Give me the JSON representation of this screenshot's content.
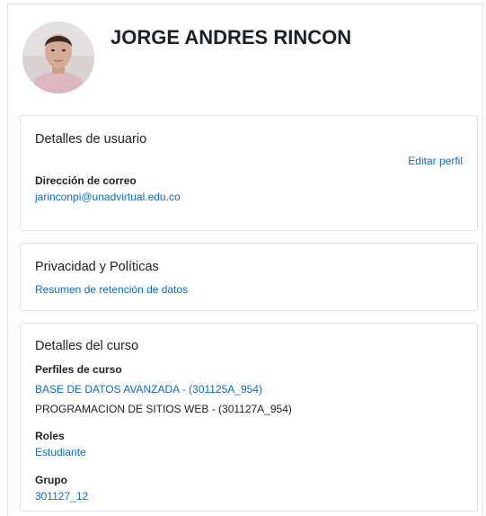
{
  "profile": {
    "full_name": "JORGE ANDRES RINCON",
    "avatar_alt": "JORGE ANDRES RINCON"
  },
  "user_details": {
    "title": "Detalles de usuario",
    "edit_link": "Editar perfil",
    "email_label": "Dirección de correo",
    "email_value": "jarinconpi@unadvirtual.edu.co"
  },
  "privacy": {
    "title": "Privacidad y Políticas",
    "retention_link": "Resumen de retención de datos"
  },
  "course_details": {
    "title": "Detalles del curso",
    "profiles_label": "Perfiles de curso",
    "courses": [
      "BASE DE DATOS AVANZADA - (301125A_954)",
      "PROGRAMACION DE SITIOS WEB - (301127A_954)"
    ],
    "roles_label": "Roles",
    "roles_value": "Estudiante",
    "group_label": "Grupo",
    "group_value": "301127_12"
  },
  "colors": {
    "link": "#0f6cbf",
    "border": "#dee2e6",
    "text": "#1d2125"
  }
}
